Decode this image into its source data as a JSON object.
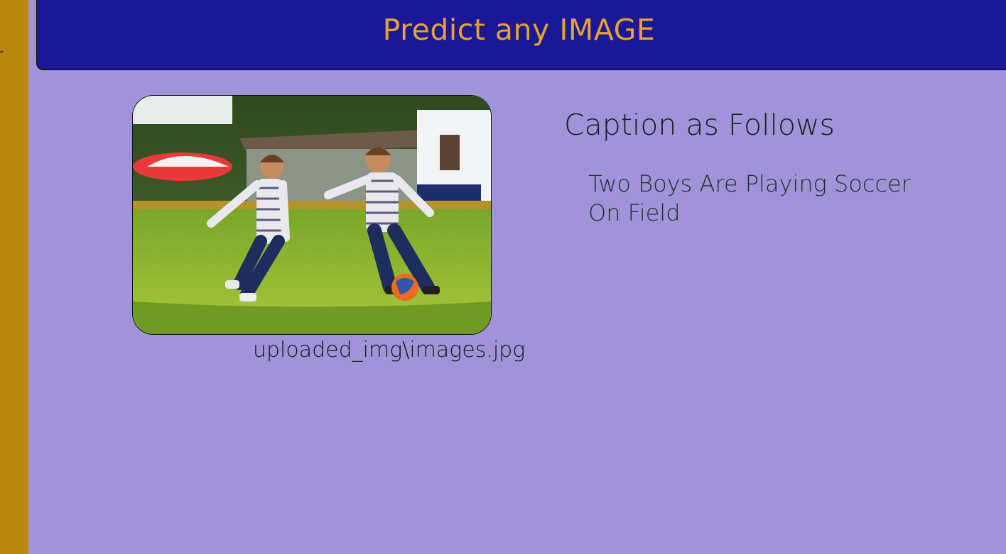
{
  "sidebar": {
    "edge_glyph": "r",
    "color": "#b8860b"
  },
  "header": {
    "title": "Predict any IMAGE",
    "bg_color": "#1a1897",
    "title_color": "#e7a032"
  },
  "upload": {
    "image_icon": "soccer-photo",
    "filename": "uploaded_img\\images.jpg"
  },
  "caption": {
    "heading": "Caption as Follows",
    "text": "Two Boys Are Playing Soccer On Field"
  },
  "page": {
    "bg_color": "#a093d9"
  }
}
